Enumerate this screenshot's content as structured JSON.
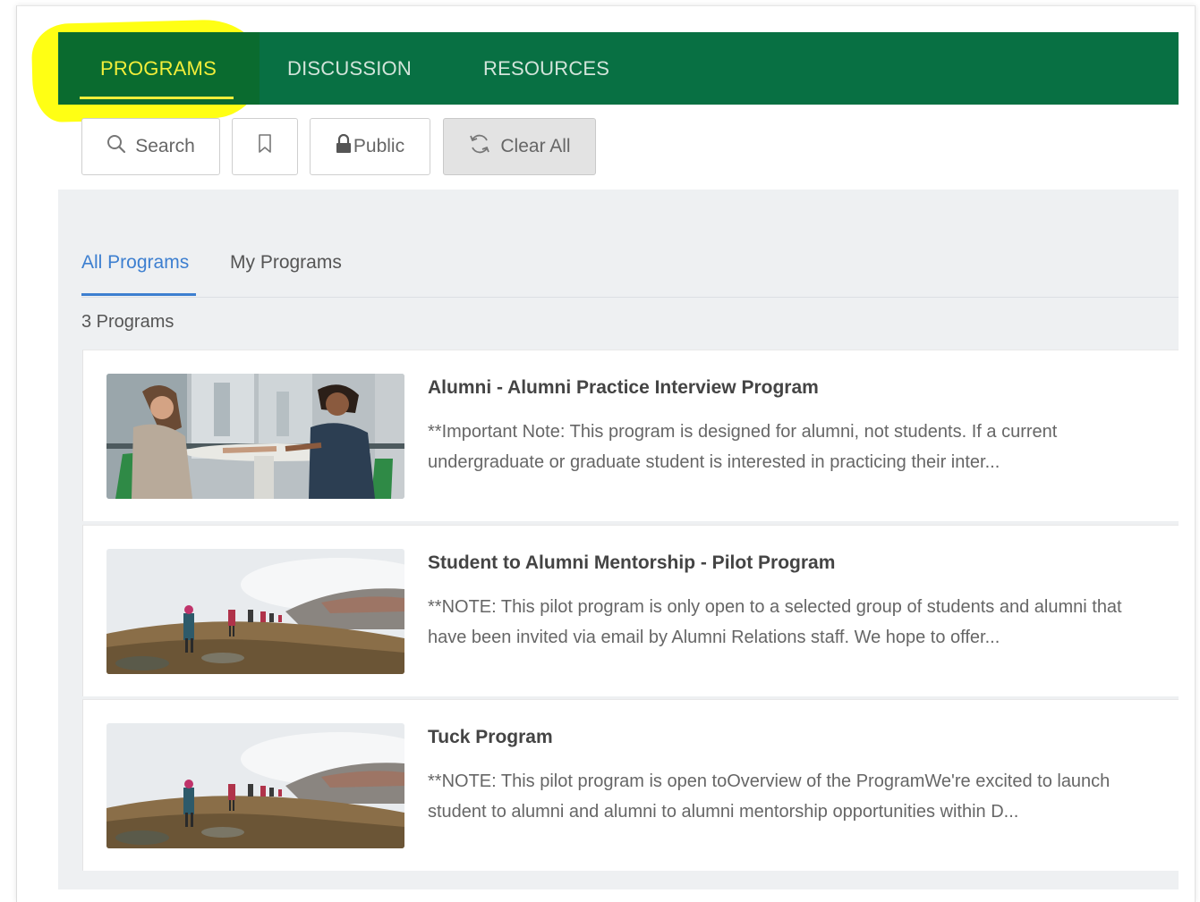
{
  "nav": {
    "tabs": [
      {
        "label": "PROGRAMS",
        "active": true
      },
      {
        "label": "DISCUSSION",
        "active": false
      },
      {
        "label": "RESOURCES",
        "active": false
      }
    ],
    "highlight_color": "#ffff00",
    "bar_color": "#087043",
    "active_color": "#f2ee3a"
  },
  "toolbar": {
    "search_label": "Search",
    "search_icon": "search-icon",
    "bookmark_icon": "bookmark-icon",
    "public_label": "Public",
    "public_icon": "lock-icon",
    "clear_label": "Clear All",
    "clear_icon": "refresh-icon"
  },
  "subtabs": [
    {
      "label": "All Programs",
      "active": true
    },
    {
      "label": "My Programs",
      "active": false
    }
  ],
  "accent_color": "#3d7fd0",
  "count_label": "3 Programs",
  "programs": [
    {
      "title": "Alumni - Alumni Practice Interview Program",
      "description": "**Important Note: This program is designed for alumni, not students. If a current undergraduate or graduate student is interested in practicing their inter...",
      "image": "interview-photo"
    },
    {
      "title": "Student to Alumni Mentorship - Pilot Program",
      "description": "**NOTE: This pilot program is only open to a selected group of students and alumni that have been invited via email by Alumni Relations staff. We hope to offer...",
      "image": "hikers-photo"
    },
    {
      "title": "Tuck Program",
      "description": "**NOTE: This pilot program is open toOverview of the ProgramWe're excited to launch student to alumni and alumni to alumni mentorship opportunities within D...",
      "image": "hikers-photo"
    }
  ]
}
